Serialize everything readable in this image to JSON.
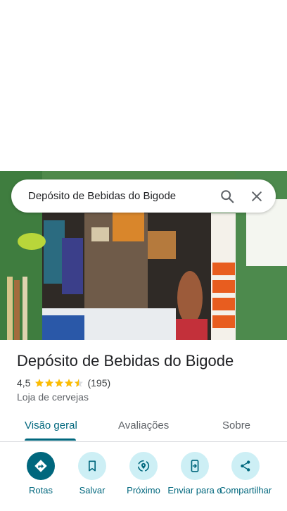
{
  "search": {
    "query": "Depósito de Bebidas do Bigode"
  },
  "place": {
    "name": "Depósito de Bebidas do Bigode",
    "rating": "4,5",
    "stars": 4.5,
    "review_count": "(195)",
    "category": "Loja de cervejas"
  },
  "tabs": [
    {
      "label": "Visão geral",
      "active": true
    },
    {
      "label": "Avaliações",
      "active": false
    },
    {
      "label": "Sobre",
      "active": false
    }
  ],
  "actions": [
    {
      "label": "Rotas",
      "icon": "directions-icon"
    },
    {
      "label": "Salvar",
      "icon": "bookmark-icon"
    },
    {
      "label": "Próximo",
      "icon": "nearby-icon"
    },
    {
      "label": "Enviar para o",
      "icon": "send-to-phone-icon"
    },
    {
      "label": "Compartilhar",
      "icon": "share-icon"
    }
  ],
  "colors": {
    "accent": "#00677d",
    "chip": "#cdeff5",
    "star": "#fbbc04"
  }
}
